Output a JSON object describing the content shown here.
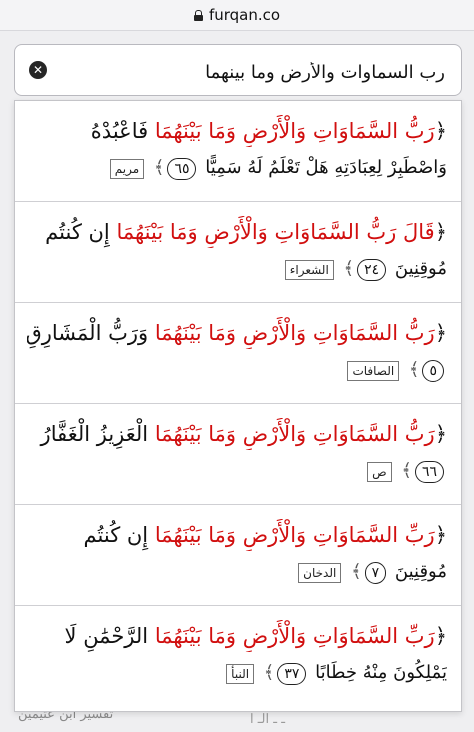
{
  "browser": {
    "url": "furqan.co"
  },
  "search": {
    "query": "رب السماوات والأرض وما بينهما",
    "clear_symbol": "✕"
  },
  "background": {
    "text_left": "تفسير ابن عثيمين",
    "text_mid": "ـ ـ الـ ا"
  },
  "results": [
    {
      "open_bracket": "﴿",
      "highlight": "رَبُّ السَّمَاوَاتِ وَالْأَرْضِ وَمَا بَيْنَهُمَا",
      "rest1": " فَاعْبُدْهُ",
      "line2": "وَاصْطَبِرْ لِعِبَادَتِهِ هَلْ تَعْلَمُ لَهُ سَمِيًّا",
      "ayah": "٦٥",
      "surah": "مريم"
    },
    {
      "open_bracket": "﴿",
      "highlight": "قَالَ رَبُّ السَّمَاوَاتِ وَالْأَرْضِ وَمَا بَيْنَهُمَا",
      "rest1": " إِن كُنتُم",
      "line2": "مُوقِنِينَ",
      "ayah": "٢٤",
      "surah": "الشعراء"
    },
    {
      "open_bracket": "﴿",
      "highlight": "رَبُّ السَّمَاوَاتِ وَالْأَرْضِ وَمَا بَيْنَهُمَا",
      "rest1": " وَرَبُّ الْمَشَارِقِ",
      "line2": "",
      "ayah": "٥",
      "surah": "الصافات"
    },
    {
      "open_bracket": "﴿",
      "highlight": "رَبُّ السَّمَاوَاتِ وَالْأَرْضِ وَمَا بَيْنَهُمَا",
      "rest1": " الْعَزِيزُ الْغَفَّارُ",
      "line2": "",
      "ayah": "٦٦",
      "surah": "ص"
    },
    {
      "open_bracket": "﴿",
      "highlight": "رَبِّ السَّمَاوَاتِ وَالْأَرْضِ وَمَا بَيْنَهُمَا",
      "rest1": " إِن كُنتُم",
      "line2": "مُوقِنِينَ",
      "ayah": "٧",
      "surah": "الدخان"
    },
    {
      "open_bracket": "﴿",
      "highlight": "رَبِّ السَّمَاوَاتِ وَالْأَرْضِ وَمَا بَيْنَهُمَا",
      "rest1": " الرَّحْمَٰنِ لَا",
      "line2": "يَمْلِكُونَ مِنْهُ خِطَابًا",
      "ayah": "٣٧",
      "surah": "النبأ"
    }
  ],
  "ornaments": {
    "close_bracket": "﴾",
    "divider": "✧"
  },
  "colors": {
    "highlight": "#d10f0f",
    "text": "#111111"
  }
}
